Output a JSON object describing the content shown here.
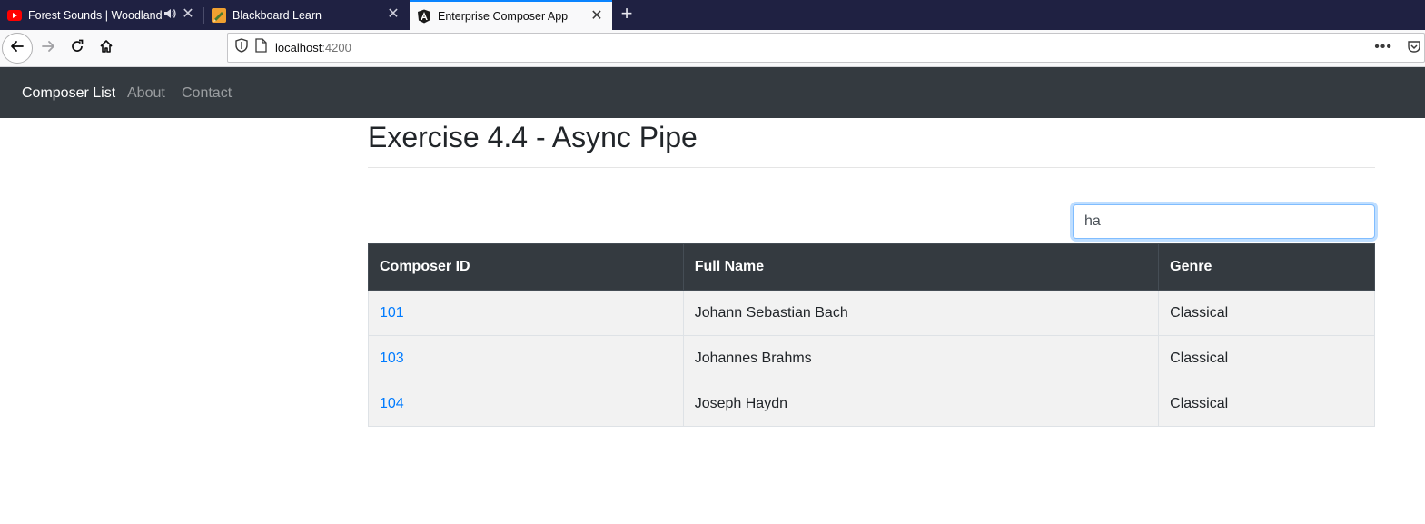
{
  "browser": {
    "tabs": [
      {
        "title": "Forest Sounds | Woodland A",
        "favicon": "youtube-icon",
        "audio": true,
        "active": false
      },
      {
        "title": "Blackboard Learn",
        "favicon": "blackboard-icon",
        "audio": false,
        "active": false
      },
      {
        "title": "Enterprise Composer App",
        "favicon": "angular-icon",
        "audio": false,
        "active": true
      }
    ],
    "url_host": "localhost",
    "url_port": ":4200"
  },
  "navbar": {
    "brand": "Composer List",
    "links": [
      "About",
      "Contact"
    ]
  },
  "main": {
    "title": "Exercise 4.4 - Async Pipe",
    "search_value": "ha",
    "table": {
      "headers": [
        "Composer ID",
        "Full Name",
        "Genre"
      ],
      "rows": [
        {
          "id": "101",
          "name": "Johann Sebastian Bach",
          "genre": "Classical"
        },
        {
          "id": "103",
          "name": "Johannes Brahms",
          "genre": "Classical"
        },
        {
          "id": "104",
          "name": "Joseph Haydn",
          "genre": "Classical"
        }
      ]
    }
  },
  "colors": {
    "tab_strip": "#1f2142",
    "navbar": "#343a40",
    "link": "#007bff",
    "accent": "#0a84ff"
  }
}
